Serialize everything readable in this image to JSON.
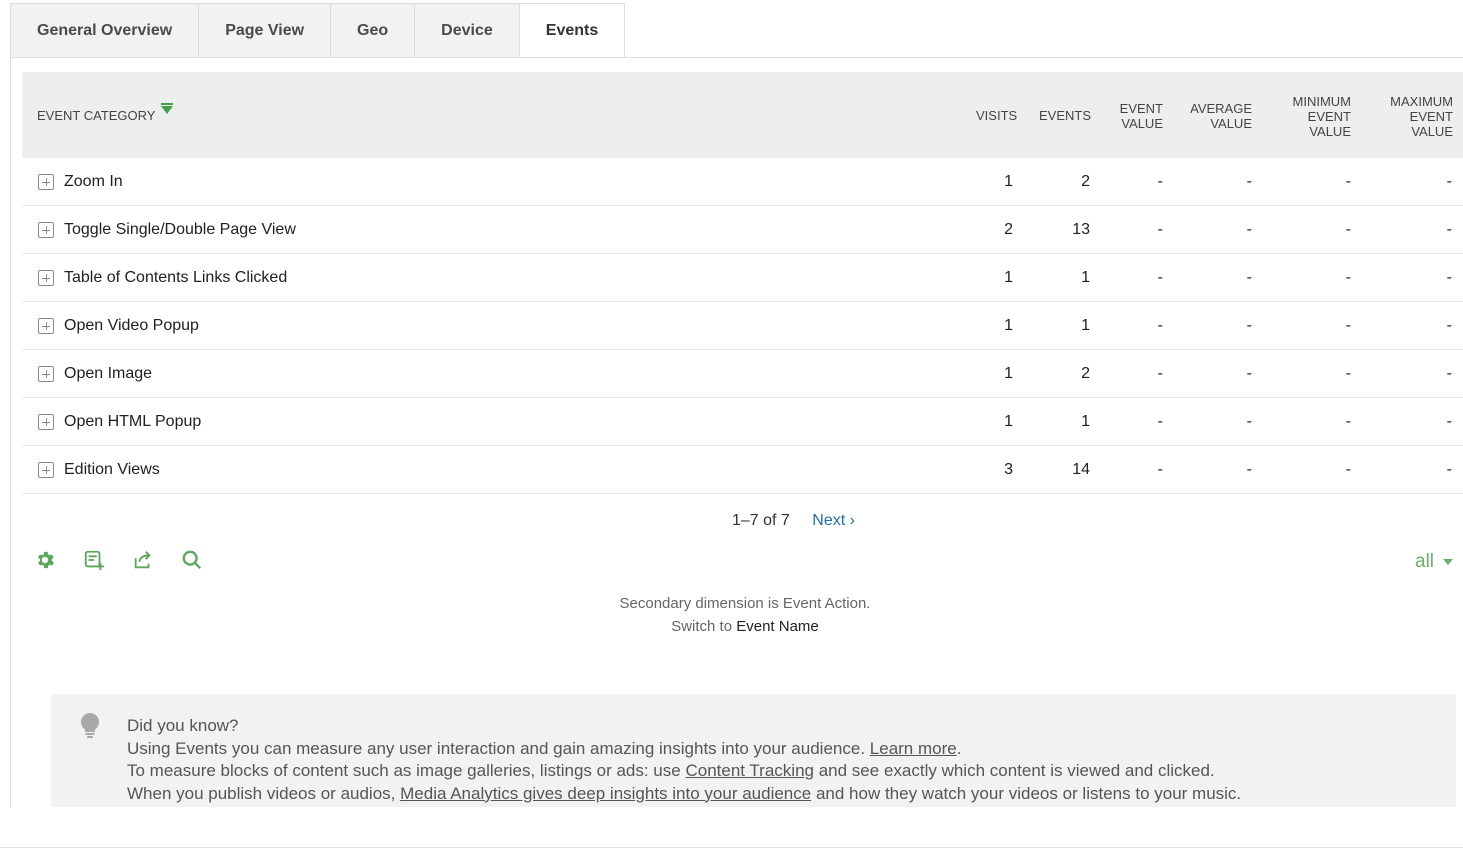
{
  "tabs": [
    {
      "label": "General Overview"
    },
    {
      "label": "Page View"
    },
    {
      "label": "Geo"
    },
    {
      "label": "Device"
    },
    {
      "label": "Events",
      "active": true
    }
  ],
  "table": {
    "columns": {
      "label": "EVENT CATEGORY",
      "visits": "VISITS",
      "events": "EVENTS",
      "event_value_1": "EVENT",
      "event_value_2": "VALUE",
      "avg_1": "AVERAGE",
      "avg_2": "VALUE",
      "min_1": "MINIMUM",
      "min_2": "EVENT",
      "min_3": "VALUE",
      "max_1": "MAXIMUM",
      "max_2": "EVENT",
      "max_3": "VALUE"
    },
    "rows": [
      {
        "label": "Zoom In",
        "visits": "1",
        "events": "2",
        "event_value": "-",
        "avg": "-",
        "min": "-",
        "max": "-"
      },
      {
        "label": "Toggle Single/Double Page View",
        "visits": "2",
        "events": "13",
        "event_value": "-",
        "avg": "-",
        "min": "-",
        "max": "-"
      },
      {
        "label": "Table of Contents Links Clicked",
        "visits": "1",
        "events": "1",
        "event_value": "-",
        "avg": "-",
        "min": "-",
        "max": "-"
      },
      {
        "label": "Open Video Popup",
        "visits": "1",
        "events": "1",
        "event_value": "-",
        "avg": "-",
        "min": "-",
        "max": "-"
      },
      {
        "label": "Open Image",
        "visits": "1",
        "events": "2",
        "event_value": "-",
        "avg": "-",
        "min": "-",
        "max": "-"
      },
      {
        "label": "Open HTML Popup",
        "visits": "1",
        "events": "1",
        "event_value": "-",
        "avg": "-",
        "min": "-",
        "max": "-"
      },
      {
        "label": "Edition Views",
        "visits": "3",
        "events": "14",
        "event_value": "-",
        "avg": "-",
        "min": "-",
        "max": "-"
      }
    ]
  },
  "pager": {
    "range": "1–7 of 7",
    "next": "Next ›"
  },
  "footer_icons": [
    "gear-icon",
    "add-table-icon",
    "export-icon",
    "search-icon"
  ],
  "limit": {
    "value": "all"
  },
  "secondary": {
    "line1": "Secondary dimension is Event Action.",
    "switch_prefix": "Switch to",
    "switch_link": "Event Name"
  },
  "tip": {
    "title": "Did you know?",
    "line1_text": "Using Events you can measure any user interaction and gain amazing insights into your audience.",
    "line1_link": "Learn more",
    "line2_prefix": "To measure blocks of content such as image galleries, listings or ads: use",
    "line2_link": "Content Tracking",
    "line2_suffix": "and see exactly which content is viewed and clicked.",
    "line3_prefix": "When you publish videos or audios,",
    "line3_link": "Media Analytics gives deep insights into your audience",
    "line3_suffix": "and how they watch your videos or listens to your music."
  },
  "colors": {
    "accent": "#43a047",
    "link": "#1f6fb2",
    "header_bg": "#eceeef"
  }
}
